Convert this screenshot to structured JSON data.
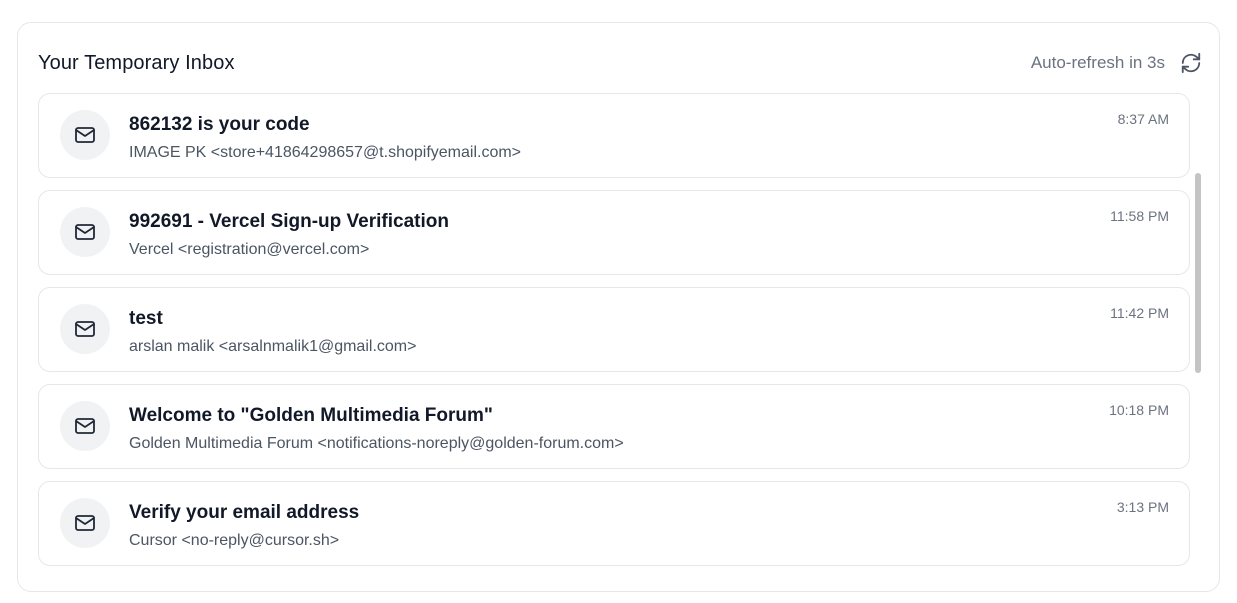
{
  "inbox": {
    "title": "Your Temporary Inbox",
    "auto_refresh": "Auto-refresh in 3s",
    "refresh_icon": "refresh-icon",
    "envelope_icon": "mail-icon",
    "emails": [
      {
        "subject": "862132 is your code",
        "sender": "IMAGE PK <store+41864298657@t.shopifyemail.com>",
        "time": "8:37 AM"
      },
      {
        "subject": "992691 - Vercel Sign-up Verification",
        "sender": "Vercel <registration@vercel.com>",
        "time": "11:58 PM"
      },
      {
        "subject": "test",
        "sender": "arslan malik <arsalnmalik1@gmail.com>",
        "time": "11:42 PM"
      },
      {
        "subject": "Welcome to \"Golden Multimedia Forum\"",
        "sender": "Golden Multimedia Forum <notifications-noreply@golden-forum.com>",
        "time": "10:18 PM"
      },
      {
        "subject": "Verify your email address",
        "sender": "Cursor <no-reply@cursor.sh>",
        "time": "3:13 PM"
      }
    ]
  }
}
